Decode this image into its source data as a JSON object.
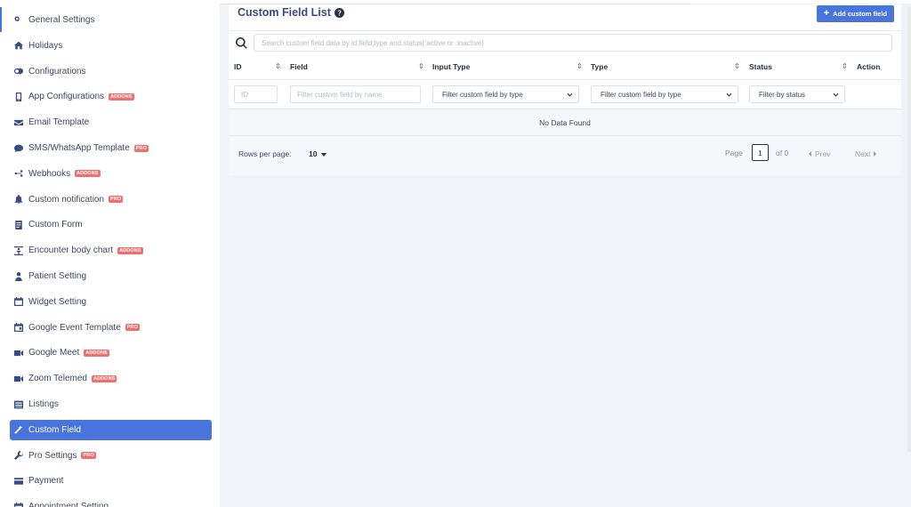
{
  "sidebar": {
    "items": [
      {
        "label": "General Settings",
        "icon": "gears-icon",
        "badge": ""
      },
      {
        "label": "Holidays",
        "icon": "home-icon",
        "badge": ""
      },
      {
        "label": "Configurations",
        "icon": "toggle-icon",
        "badge": ""
      },
      {
        "label": "App Configurations",
        "icon": "mobile-icon",
        "badge": "ADDONS"
      },
      {
        "label": "Email Template",
        "icon": "envelope-icon",
        "badge": ""
      },
      {
        "label": "SMS/WhatsApp Template",
        "icon": "chat-icon",
        "badge": "PRO"
      },
      {
        "label": "Webhooks",
        "icon": "webhook-icon",
        "badge": "ADDONS"
      },
      {
        "label": "Custom notification",
        "icon": "bell-icon",
        "badge": "PRO"
      },
      {
        "label": "Custom Form",
        "icon": "form-icon",
        "badge": ""
      },
      {
        "label": "Encounter body chart",
        "icon": "body-chart-icon",
        "badge": "ADDONS"
      },
      {
        "label": "Patient Setting",
        "icon": "patient-icon",
        "badge": ""
      },
      {
        "label": "Widget Setting",
        "icon": "calendar-icon",
        "badge": ""
      },
      {
        "label": "Google Event Template",
        "icon": "calendar-event-icon",
        "badge": "PRO"
      },
      {
        "label": "Google Meet",
        "icon": "video-icon",
        "badge": "ADDONS"
      },
      {
        "label": "Zoom Telemed",
        "icon": "video-icon",
        "badge": "ADDONS"
      },
      {
        "label": "Listings",
        "icon": "list-icon",
        "badge": ""
      },
      {
        "label": "Custom Field",
        "icon": "magic-icon",
        "badge": ""
      },
      {
        "label": "Pro Settings",
        "icon": "wrench-icon",
        "badge": "PRO"
      },
      {
        "label": "Payment",
        "icon": "card-icon",
        "badge": ""
      },
      {
        "label": "Appointment Setting",
        "icon": "calendar-icon",
        "badge": ""
      }
    ],
    "active_index": 16,
    "accent_color": "#4874dc",
    "badge_color": "#f26e6e"
  },
  "header": {
    "title": "Custom Field List",
    "add_button": "Add custom field"
  },
  "search": {
    "placeholder": "Search custom field data by id,field,type and status(:active or :inactive)"
  },
  "table": {
    "columns": [
      "ID",
      "Field",
      "Input Type",
      "Type",
      "Status",
      "Action"
    ],
    "filters": {
      "id_placeholder": "ID",
      "field_placeholder": "Filter custom field by name",
      "input_type_selected": "Filter custom field by type",
      "type_selected": "Filter custom field by type",
      "status_selected": "Filter by status"
    },
    "empty_message": "No Data Found"
  },
  "pagination": {
    "rows_per_page_label": "Rows per page:",
    "rows_per_page_value": "10",
    "page_label": "Page",
    "current_page": "1",
    "of_label": "of 0",
    "prev_label": "Prev",
    "next_label": "Next"
  }
}
